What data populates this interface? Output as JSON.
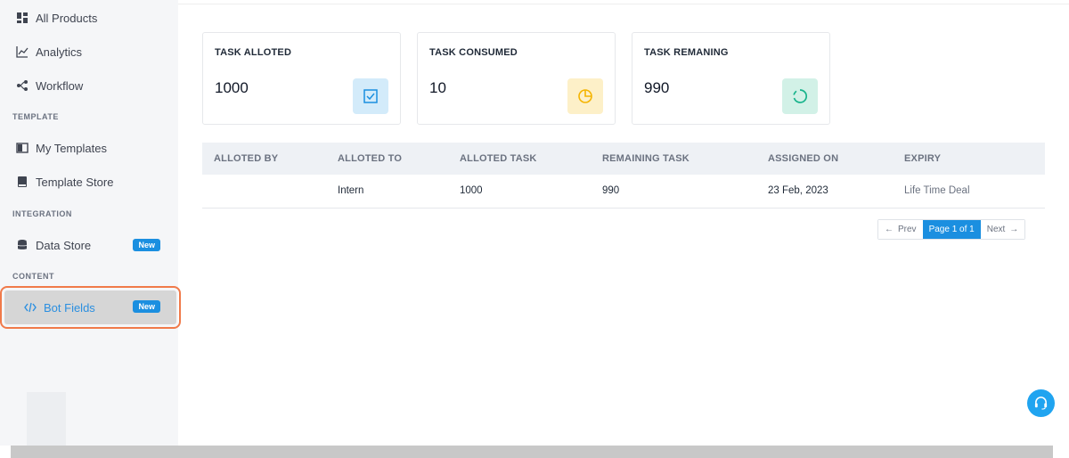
{
  "sidebar": {
    "items": [
      {
        "label": "All Products",
        "icon": "grid-icon"
      },
      {
        "label": "Analytics",
        "icon": "chart-line-icon"
      },
      {
        "label": "Workflow",
        "icon": "workflow-icon"
      }
    ],
    "sections": [
      {
        "label": "TEMPLATE",
        "items": [
          {
            "label": "My Templates",
            "icon": "template-icon"
          },
          {
            "label": "Template Store",
            "icon": "book-icon"
          }
        ]
      },
      {
        "label": "INTEGRATION",
        "items": [
          {
            "label": "Data Store",
            "icon": "database-icon",
            "badge": "New"
          }
        ]
      },
      {
        "label": "CONTENT",
        "items": [
          {
            "label": "Bot Fields",
            "icon": "code-icon",
            "badge": "New",
            "active": true
          }
        ]
      }
    ]
  },
  "cards": [
    {
      "title": "TASK ALLOTED",
      "value": "1000",
      "icon": "checkbox-icon",
      "color": "#1b8fe0",
      "bg": "#d3ebfa"
    },
    {
      "title": "TASK CONSUMED",
      "value": "10",
      "icon": "pie-icon",
      "color": "#f5b400",
      "bg": "#fdf0c8"
    },
    {
      "title": "TASK REMANING",
      "value": "990",
      "icon": "spinner-icon",
      "color": "#19b48c",
      "bg": "#d2f1e7"
    }
  ],
  "table": {
    "headers": [
      "ALLOTED BY",
      "ALLOTED TO",
      "ALLOTED TASK",
      "REMAINING TASK",
      "ASSIGNED ON",
      "EXPIRY"
    ],
    "rows": [
      [
        "",
        "Intern",
        "1000",
        "990",
        "23 Feb, 2023",
        "Life Time Deal"
      ]
    ]
  },
  "pagination": {
    "prev": "Prev",
    "current": "Page 1 of 1",
    "next": "Next"
  },
  "colors": {
    "accent": "#1b8fe0",
    "highlight_border": "#f07a4a"
  }
}
